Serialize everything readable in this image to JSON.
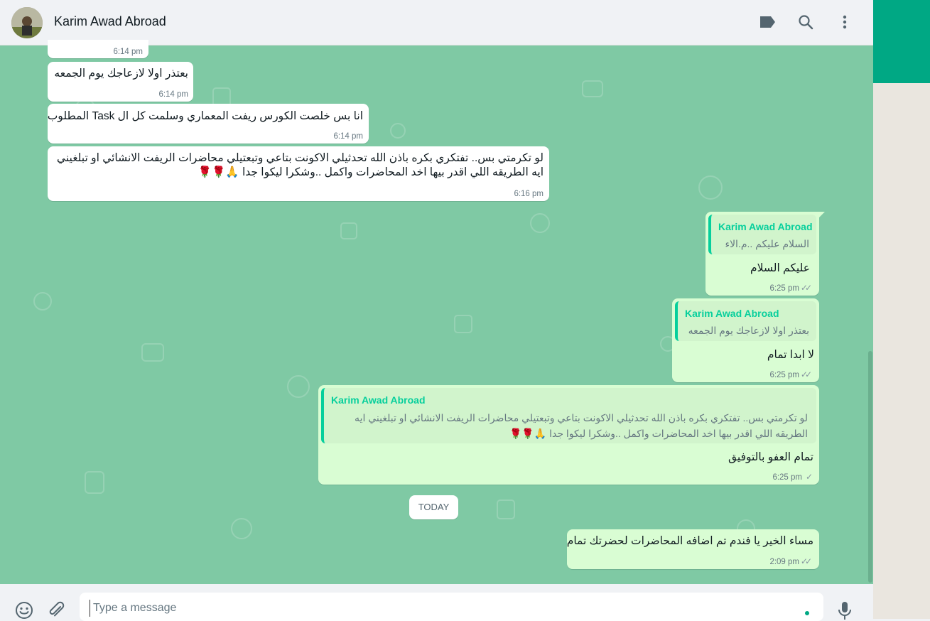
{
  "header": {
    "contact_name": "Karim Awad Abroad"
  },
  "messages": [
    {
      "time": "6:14 pm"
    },
    {
      "text": "بعتذر اولا لازعاجك يوم الجمعه",
      "time": "6:14 pm"
    },
    {
      "text": "انا بس خلصت الكورس ريفت المعماري وسلمت كل ال Task المطلوب",
      "time": "6:14 pm"
    },
    {
      "line1": "لو تكرمتي بس.. تفتكري بكره باذن الله تحدثيلي الاكونت بتاعي وتبعتيلي محاضرات الريفت الانشائي او تبلغيني",
      "line2": "ايه الطريقه اللي اقدر بيها اخد المحاضرات واكمل ..وشكرا ليكوا جدا 🙏🌹🌹",
      "time": "6:16 pm"
    },
    {
      "quote_name": "Karim Awad Abroad",
      "quote_text": "السلام عليكم ..م.الاء",
      "text": "عليكم السلام",
      "time": "6:25 pm",
      "ticks": "✓✓"
    },
    {
      "quote_name": "Karim Awad Abroad",
      "quote_text": "بعتذر اولا لازعاجك يوم الجمعه",
      "text": "لا ابدا تمام",
      "time": "6:25 pm",
      "ticks": "✓✓"
    },
    {
      "quote_name": "Karim Awad Abroad",
      "quote_line1": "لو تكرمتي بس.. تفتكري بكره باذن الله تحدثيلي الاكونت بتاعي وتبعتيلي محاضرات الريفت الانشائي او تبلغيني ايه",
      "quote_line2": "الطريقه اللي اقدر بيها اخد المحاضرات واكمل ..وشكرا ليكوا جدا 🙏🌹🌹",
      "text": "تمام العفو بالتوفيق",
      "time": "6:25 pm",
      "ticks": "✓"
    },
    {
      "text": "مساء الخير يا فندم تم اضافه المحاضرات لحضرتك تمام",
      "time": "2:09 pm",
      "ticks": "✓✓"
    }
  ],
  "date_divider": "TODAY",
  "composer": {
    "placeholder": "Type a message"
  },
  "icons": {
    "label": "label-icon",
    "search": "search-icon",
    "menu": "menu-icon",
    "emoji": "emoji-icon",
    "attach": "attach-icon",
    "mic": "mic-icon"
  },
  "colors": {
    "accent": "#00a884",
    "outgoing": "#d9fdd3",
    "incoming": "#ffffff",
    "wallpaper": "#7fc9a4"
  }
}
